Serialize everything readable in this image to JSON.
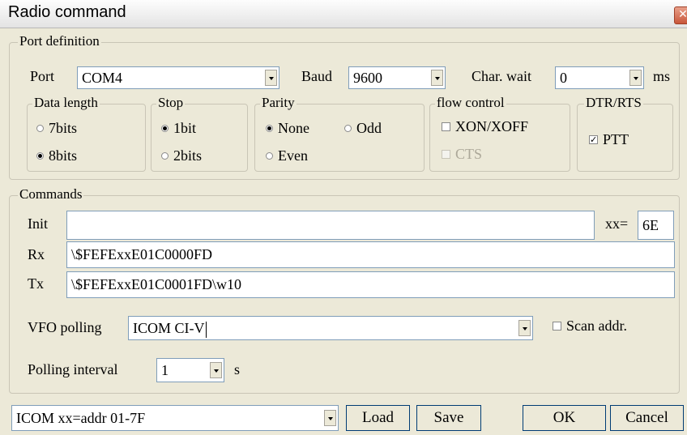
{
  "window": {
    "title": "Radio command",
    "close_glyph": "✕"
  },
  "port_definition": {
    "legend": "Port definition",
    "port": {
      "label": "Port",
      "value": "COM4"
    },
    "baud": {
      "label": "Baud",
      "value": "9600"
    },
    "char_wait": {
      "label": "Char. wait",
      "value": "0",
      "unit": "ms"
    },
    "data_length": {
      "legend": "Data length",
      "options": [
        "7bits",
        "8bits"
      ],
      "selected": "8bits"
    },
    "stop": {
      "legend": "Stop",
      "options": [
        "1bit",
        "2bits"
      ],
      "selected": "1bit"
    },
    "parity": {
      "legend": "Parity",
      "options": [
        "None",
        "Odd",
        "Even"
      ],
      "selected": "None"
    },
    "flow_control": {
      "legend": "flow control",
      "xon_xoff": {
        "label": "XON/XOFF",
        "checked": false
      },
      "cts": {
        "label": "CTS",
        "checked": false,
        "disabled": true
      }
    },
    "dtr_rts": {
      "legend": "DTR/RTS",
      "ptt": {
        "label": "PTT",
        "checked": true
      }
    }
  },
  "commands": {
    "legend": "Commands",
    "init": {
      "label": "Init",
      "value": ""
    },
    "xx": {
      "label": "xx=",
      "value": "6E"
    },
    "rx": {
      "label": "Rx",
      "value": "\\$FEFExxE01C0000FD"
    },
    "tx": {
      "label": "Tx",
      "value": "\\$FEFExxE01C0001FD\\w10"
    },
    "vfo_polling": {
      "label": "VFO polling",
      "value": "ICOM CI-V"
    },
    "scan_addr": {
      "label": "Scan addr.",
      "checked": false
    },
    "polling_interval": {
      "label": "Polling interval",
      "value": "1",
      "unit": "s"
    }
  },
  "footer": {
    "preset": "ICOM  xx=addr 01-7F",
    "load": "Load",
    "save": "Save",
    "ok": "OK",
    "cancel": "Cancel"
  },
  "colors": {
    "window_bg": "#ece9d8",
    "field_border": "#7f9db9",
    "button_border": "#003c74",
    "close_button": "#c8563a"
  }
}
